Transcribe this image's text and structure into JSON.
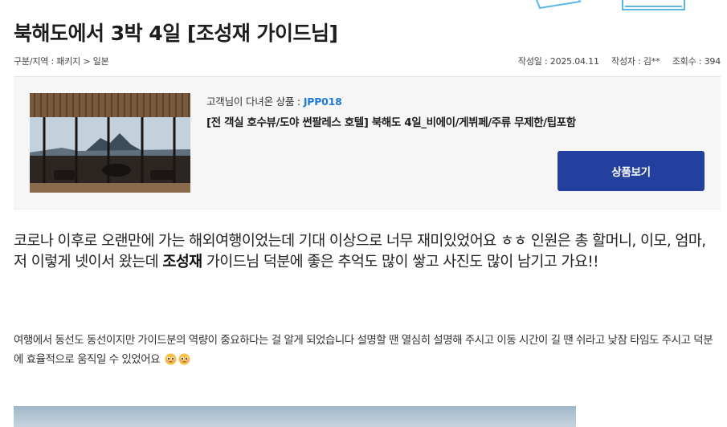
{
  "post": {
    "title": "북해도에서 3박 4일 [조성재 가이드님]",
    "category": "구분/지역 : 패키지 > 일본",
    "meta": {
      "date_label": "작성일 : 2025.04.11",
      "author_label": "작성자 : 김**",
      "views_label": "조회수 : 394"
    }
  },
  "product": {
    "visited_prefix": "고객님이 다녀온 상품 : ",
    "code": "JPP018",
    "name": "[전 객실 호수뷰/도야 썬팔레스 호텔] 북해도 4일_비에이/게뷔페/주류 무제한/팁포함",
    "view_button": "상품보기"
  },
  "content": {
    "lead_before": "코로나 이후로 오랜만에 가는 해외여행이었는데 기대 이상으로 너무 재미있었어요 ㅎㅎ 인원은 총 할머니, 이모, 엄마, 저 이렇게 넷이서 왔는데 ",
    "lead_bold": "조성재",
    "lead_after": " 가이드님 덕분에 좋은 추억도 많이 쌓고 사진도 많이 남기고 가요!!",
    "paragraph": "여행에서 동선도 동선이지만 가이드분의 역량이 중요하다는 걸 알게 되었습니다 설명할 땐 열심히 설명해 주시고 이동 시간이 길 땐 쉬라고 낮잠 타임도 주시고 덕분에 효율적으로 움직일 수 있었어요"
  },
  "icons": {
    "product_thumbnail": "hotel-lounge-lake-view-image",
    "emoji": "pleading-face-emoji"
  },
  "colors": {
    "accent_blue": "#1f7bd6",
    "button_navy": "#23409f"
  }
}
